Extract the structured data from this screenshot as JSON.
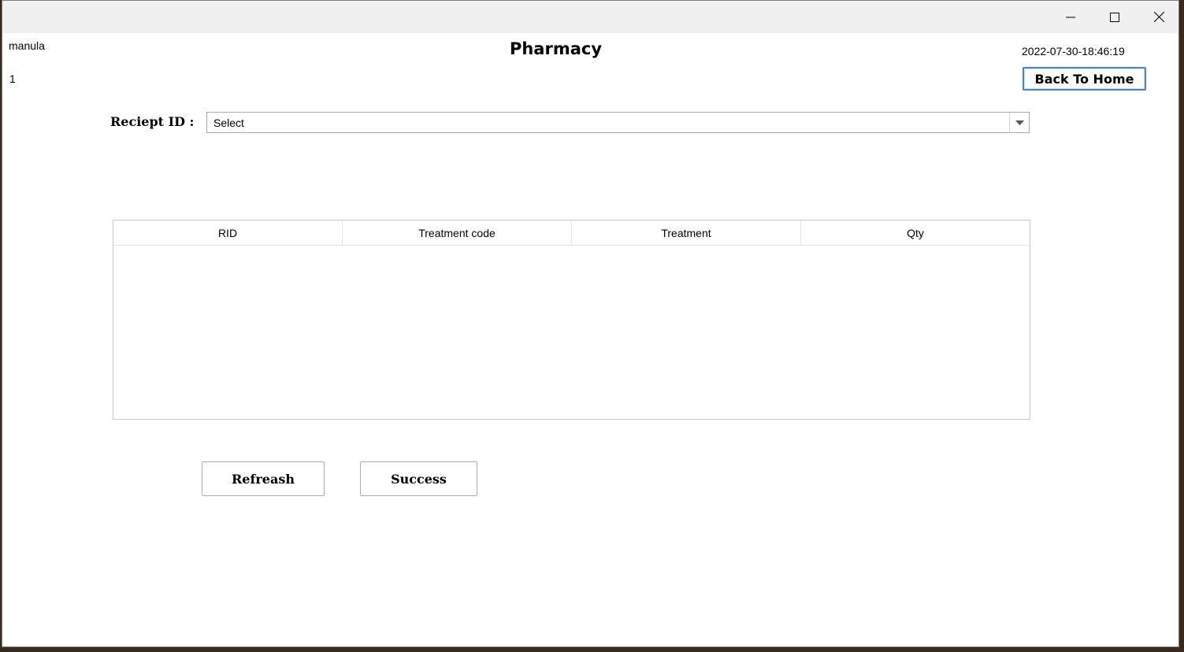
{
  "window": {
    "controls": {
      "minimize": "minimize-icon",
      "maximize": "maximize-icon",
      "close": "close-icon"
    }
  },
  "header": {
    "user_name": "manula",
    "user_id": "1",
    "title": "Pharmacy",
    "datetime": "2022-07-30-18:46:19",
    "back_label": "Back To Home"
  },
  "receipt": {
    "label": "Reciept ID :",
    "selected": "Select"
  },
  "table": {
    "columns": [
      "RID",
      "Treatment code",
      "Treatment",
      "Qty"
    ],
    "rows": []
  },
  "actions": {
    "refresh_label": "Refreash",
    "success_label": "Success"
  },
  "colors": {
    "focus_border": "#4b86c8",
    "titlebar": "#f0f0f0"
  }
}
